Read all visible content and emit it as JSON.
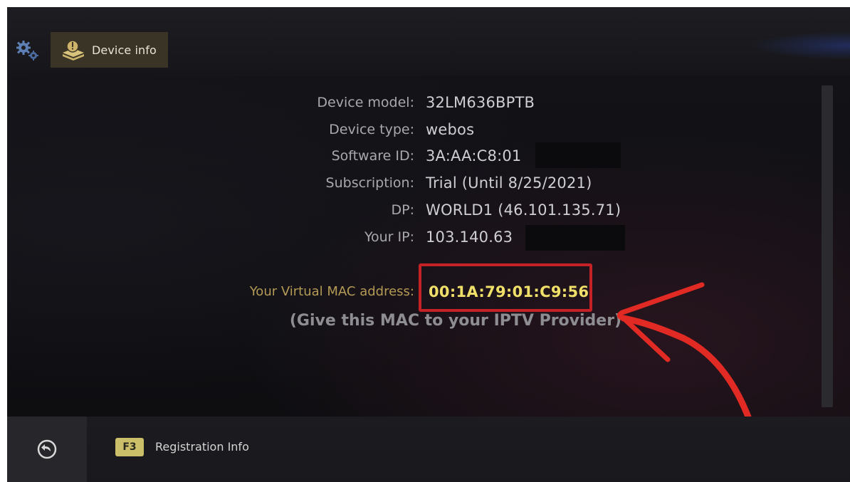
{
  "header": {
    "tab_label": "Device info"
  },
  "info": {
    "rows": [
      {
        "label": "Device model:",
        "value": "32LM636BPTB"
      },
      {
        "label": "Device type:",
        "value": "webos"
      },
      {
        "label": "Software ID:",
        "value": "3A:AA:C8:01"
      },
      {
        "label": "Subscription:",
        "value": "Trial (Until 8/25/2021)"
      },
      {
        "label": "DP:",
        "value": "WORLD1 (46.101.135.71)"
      },
      {
        "label": "Your IP:",
        "value": "103.140.63"
      }
    ],
    "mac_label": "Your Virtual MAC address:",
    "mac_value": "00:1A:79:01:C9:56",
    "mac_hint": "(Give this MAC to your IPTV Provider)"
  },
  "footer": {
    "f3_key": "F3",
    "f3_label": "Registration Info"
  },
  "colors": {
    "accent_yellow": "#f0e06a",
    "highlight_red": "#c42226",
    "arrow_red": "#e02a23"
  },
  "icons": {
    "settings": "gears-icon",
    "device": "device-info-icon",
    "back": "back-arrow-icon"
  }
}
